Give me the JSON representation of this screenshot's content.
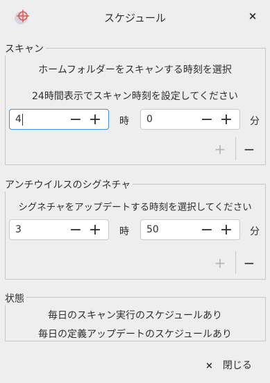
{
  "window": {
    "title": "スケジュール",
    "app_icon": "crosshair-logo-icon",
    "close_icon": "×"
  },
  "scan": {
    "legend": "スキャン",
    "heading": "ホームフォルダーをスキャンする時刻を選択",
    "hint": "24時間表示でスキャン時刻を設定してください",
    "hour_value": "4",
    "hour_unit": "時",
    "minute_value": "0",
    "minute_unit": "分",
    "add_label": "+",
    "remove_label": "−"
  },
  "signature": {
    "legend": "アンチウイルスのシグネチャ",
    "heading": "シグネチャをアップデートする時刻を選択してください",
    "hour_value": "3",
    "hour_unit": "時",
    "minute_value": "50",
    "minute_unit": "分",
    "add_label": "+",
    "remove_label": "−"
  },
  "status": {
    "legend": "状態",
    "line1": "毎日のスキャン実行のスケジュールあり",
    "line2": "毎日の定義アップデートのスケジュールあり"
  },
  "footer": {
    "close_icon": "×",
    "close_label": "閉じる"
  },
  "spin_labels": {
    "minus": "−",
    "plus": "+"
  },
  "colors": {
    "background": "#eeeeee",
    "focus": "#3a8ee6",
    "icon_red": "#e0584a"
  }
}
